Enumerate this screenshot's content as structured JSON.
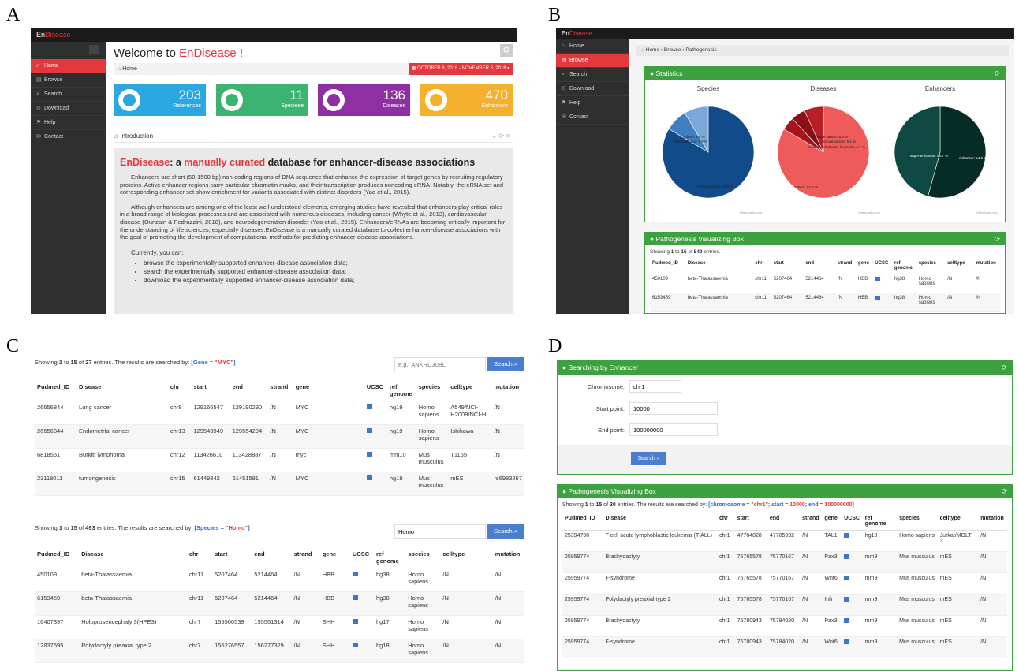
{
  "labels": {
    "a": "A",
    "b": "B",
    "c": "C",
    "d": "D"
  },
  "colors": {
    "accent": "#e4393c",
    "green": "#3da13f",
    "link": "#2a6ebb",
    "blue_btn": "#4a7fd0",
    "dark": "#1b1b1b"
  },
  "brand": {
    "en": "En",
    "disease": "Disease"
  },
  "panel_a": {
    "nav": [
      {
        "icon": "home-icon",
        "label": "Home"
      },
      {
        "icon": "browse-icon",
        "label": "Browse"
      },
      {
        "icon": "search-icon",
        "label": "Search"
      },
      {
        "icon": "download-icon",
        "label": "Download"
      },
      {
        "icon": "help-icon",
        "label": "Help"
      },
      {
        "icon": "contact-icon",
        "label": "Contact"
      }
    ],
    "welcome_prefix": "Welcome to ",
    "welcome_brand": "EnDisease",
    "welcome_suffix": " !",
    "breadcrumb": "Home",
    "date_range": "OCTOBER 8, 2018 - NOVEMBER 6, 2018",
    "cards": [
      {
        "num": "203",
        "label": "References",
        "color": "#2aa7e1"
      },
      {
        "num": "11",
        "label": "Speciese",
        "color": "#3cb371"
      },
      {
        "num": "136",
        "label": "Diseases",
        "color": "#8e2fa3"
      },
      {
        "num": "470",
        "label": "Enhancers",
        "color": "#f5b02e"
      }
    ],
    "intro_header": "Introduction",
    "heading_en": "EnDisease",
    "heading_mid": ": a ",
    "heading_red": "manually curated",
    "heading_rest": " database for enhancer-disease associations",
    "para1": "Enhancers are short (50-1500 bp) non-coding regions of DNA sequence that enhance the expression of target genes by recruiting regulatory proteins. Active enhancer regions carry particular chromatin marks, and their transcription produces noncoding eRNA. Notably, the eRNA set and corresponding enhancer set show enrichment for variants associated with distinct disorders (Yao et al., 2015).",
    "para2": "Although enhancers are among one of the least well-understood elements, emerging studies have revealed that enhancers play critical roles in a broad range of biological processes and are associated with numerous diseases, including cancer (Whyte et al., 2013), cardiovascular disease (Ounzain & Pedrazzini, 2018), and neurodegeneration disorder (Yao et al., 2015). Enhancers/eRNAs are becoming critically important for the understanding of life sciences, especially diseases.EnDisease is a manually curated database to collect enhancer-disease associations with the goal of promoting the development of computational methods for predicting enhancer-disease associations.",
    "currently": "Currently, you can:",
    "bullets": [
      "browse the experimentally supported enhancer-disease association data;",
      "search the experimentally supported enhancer-disease association data;",
      "download the experimentally supported enhancer-disease association data;"
    ]
  },
  "panel_b": {
    "nav": [
      "Home",
      "Browse",
      "Search",
      "Download",
      "Help",
      "Contact"
    ],
    "breadcrumb": [
      "Home",
      "Browse",
      "Pathogenesis"
    ],
    "stats_title": "Statistics",
    "pie_titles": [
      "Species",
      "Diseases",
      "Enhancers"
    ],
    "pie_labels": {
      "species_main": "Homo sapiens: 83.5 %",
      "species_a": "Others: 8.6 %",
      "species_b": "Mus musculus: 7.9 %",
      "diseases_main": "others: 83.4 %",
      "diseases_a": "prostate cancer: 6.8 %",
      "diseases_b": "breast cancer: 5.1 %",
      "diseases_c": "acute lymphoblastic leukemia: 4.7 %",
      "enh_a": "super-enhancer: 45.7 %",
      "enh_b": "enhancer: 54.3 %"
    },
    "credit": "Highcharts.com",
    "box_title": "Pathogenesis Visualizing Box",
    "showing": {
      "pre": "Showing ",
      "from": "1",
      "mid": " to ",
      "to": "15",
      "of": " of ",
      "total": "549",
      "post": " entries."
    },
    "columns": [
      "Pudmed_ID",
      "Disease",
      "chr",
      "start",
      "end",
      "strand",
      "gene",
      "UCSC",
      "ref genome",
      "species",
      "celltype",
      "mutation"
    ],
    "rows": [
      [
        "450109",
        "beta-Thalassaemia",
        "chr11",
        "5207464",
        "5214464",
        "/N",
        "HBB",
        "",
        "hg38",
        "Homo sapiens",
        "/N",
        "/N"
      ],
      [
        "6153459",
        "beta-Thalassaemia",
        "chr11",
        "5207464",
        "5214464",
        "/N",
        "HBB",
        "",
        "hg38",
        "Homo sapiens",
        "/N",
        "/N"
      ]
    ]
  },
  "panel_c": {
    "top": {
      "showing_pre": "Showing ",
      "from": "1",
      "mid": " to ",
      "to": "15",
      "of": " of ",
      "total": "27",
      "searched_pre": " entries. The results are searched by: ",
      "q_open": "[Gene = ",
      "q_val": "\"MYC\"",
      "q_close": "]",
      "search_placeholder": "e.g.: ANKRD30BL",
      "search_button": "Search",
      "columns": [
        "Pudmed_ID",
        "Disease",
        "chr",
        "start",
        "end",
        "strand",
        "gene",
        "UCSC",
        "ref genome",
        "species",
        "celltype",
        "mutation"
      ],
      "rows": [
        [
          "26656844",
          "Lung cancer",
          "chr8",
          "129166547",
          "129190290",
          "/N",
          "MYC",
          "",
          "hg19",
          "Homo sapiens",
          "A549/NCI-H2009/NCI-H",
          "/N"
        ],
        [
          "26656844",
          "Endometrial cancer",
          "chr13",
          "129543949",
          "129554294",
          "/N",
          "MYC",
          "",
          "hg19",
          "Homo sapiens",
          "Ishikawa",
          "/N"
        ],
        [
          "6818551",
          "Burkitt lymphoma",
          "chr12",
          "113426610",
          "113428887",
          "/N",
          "myc",
          "",
          "mm10",
          "Mus musculus",
          "T1165",
          "/N"
        ],
        [
          "23118011",
          "tumorigenesis",
          "chr15",
          "61449842",
          "61451581",
          "/N",
          "MYC",
          "",
          "hg19",
          "Mus musculus",
          "mES",
          "rs6983267"
        ]
      ]
    },
    "bottom": {
      "showing_pre": "Showing ",
      "from": "1",
      "mid": " to ",
      "to": "15",
      "of": " of ",
      "total": "493",
      "searched_pre": " entries. The results are searched by: ",
      "q_open": "[Species = ",
      "q_val": "\"Homo\"",
      "q_close": "]",
      "search_value": "Homo",
      "search_button": "Search",
      "columns": [
        "Pudmed_ID",
        "Disease",
        "chr",
        "start",
        "end",
        "strand",
        "gene",
        "UCSC",
        "ref genome",
        "species",
        "celltype",
        "mutation"
      ],
      "rows": [
        [
          "450109",
          "beta-Thalassaemia",
          "chr11",
          "5207464",
          "5214464",
          "/N",
          "HBB",
          "",
          "hg38",
          "Homo sapiens",
          "/N",
          "/N"
        ],
        [
          "6153459",
          "beta-Thalassaemia",
          "chr11",
          "5207464",
          "5214464",
          "/N",
          "HBB",
          "",
          "hg38",
          "Homo sapiens",
          "/N",
          "/N"
        ],
        [
          "16407397",
          "Holoprosencephaly 3(HPE3)",
          "chr7",
          "155560539",
          "155561314",
          "/N",
          "SHH",
          "",
          "hg17",
          "Homo sapiens",
          "/N",
          "/N"
        ],
        [
          "12837695",
          "Polydactyly preaxial type 2",
          "chr7",
          "156276557",
          "156277329",
          "/N",
          "SHH",
          "",
          "hg18",
          "Homo sapiens",
          "/N",
          "/N"
        ]
      ]
    }
  },
  "panel_d": {
    "form_title": "Searching by Enhancer",
    "chromosome_label": "Chromosome:",
    "chromosome_value": "chr1",
    "start_label": "Start point:",
    "start_value": "10000",
    "end_label": "End point:",
    "end_value": "100000000",
    "search_button": "Search",
    "box_title": "Pathogenesis Visualizing Box",
    "showing_pre": "Showing ",
    "from": "1",
    "mid": " to ",
    "to": "15",
    "of": " of ",
    "total": "30",
    "searched_pre": " entries. The results are searched by: ",
    "q_open": "[chromosome = ",
    "q1": "\"chr1\"",
    "q_sep1": "; start = ",
    "q2": "10000",
    "q_sep2": "; end = ",
    "q3": "100000000",
    "q_close": "]",
    "columns": [
      "Pudmed_ID",
      "Disease",
      "chr",
      "start",
      "end",
      "strand",
      "gene",
      "UCSC",
      "ref genome",
      "species",
      "celltype",
      "mutation"
    ],
    "rows": [
      [
        "25394790",
        "T-cell acute lymphoblastic leukemia (T-ALL)",
        "chr1",
        "47704828",
        "47705032",
        "/N",
        "TAL1",
        "",
        "hg19",
        "Homo sapiens",
        "Jurkat/MOLT-3",
        "/N"
      ],
      [
        "25959774",
        "Brachydactyly",
        "chr1",
        "75765578",
        "75770167",
        "/N",
        "Pax3",
        "",
        "mm9",
        "Mus musculus",
        "mES",
        "/N"
      ],
      [
        "25959774",
        "F-syndrome",
        "chr1",
        "75765578",
        "75770167",
        "/N",
        "Wnt6",
        "",
        "mm9",
        "Mus musculus",
        "mES",
        "/N"
      ],
      [
        "25959774",
        "Polydactyly preaxial type 2",
        "chr1",
        "75765578",
        "75770167",
        "/N",
        "Ihh",
        "",
        "mm9",
        "Mus musculus",
        "mES",
        "/N"
      ],
      [
        "25959774",
        "Brachydactyly",
        "chr1",
        "75780943",
        "75784020",
        "/N",
        "Pax3",
        "",
        "mm9",
        "Mus musculus",
        "mES",
        "/N"
      ],
      [
        "25959774",
        "F-syndrome",
        "chr1",
        "75780943",
        "75784020",
        "/N",
        "Wnt6",
        "",
        "mm9",
        "Mus musculus",
        "mES",
        "/N"
      ]
    ]
  }
}
